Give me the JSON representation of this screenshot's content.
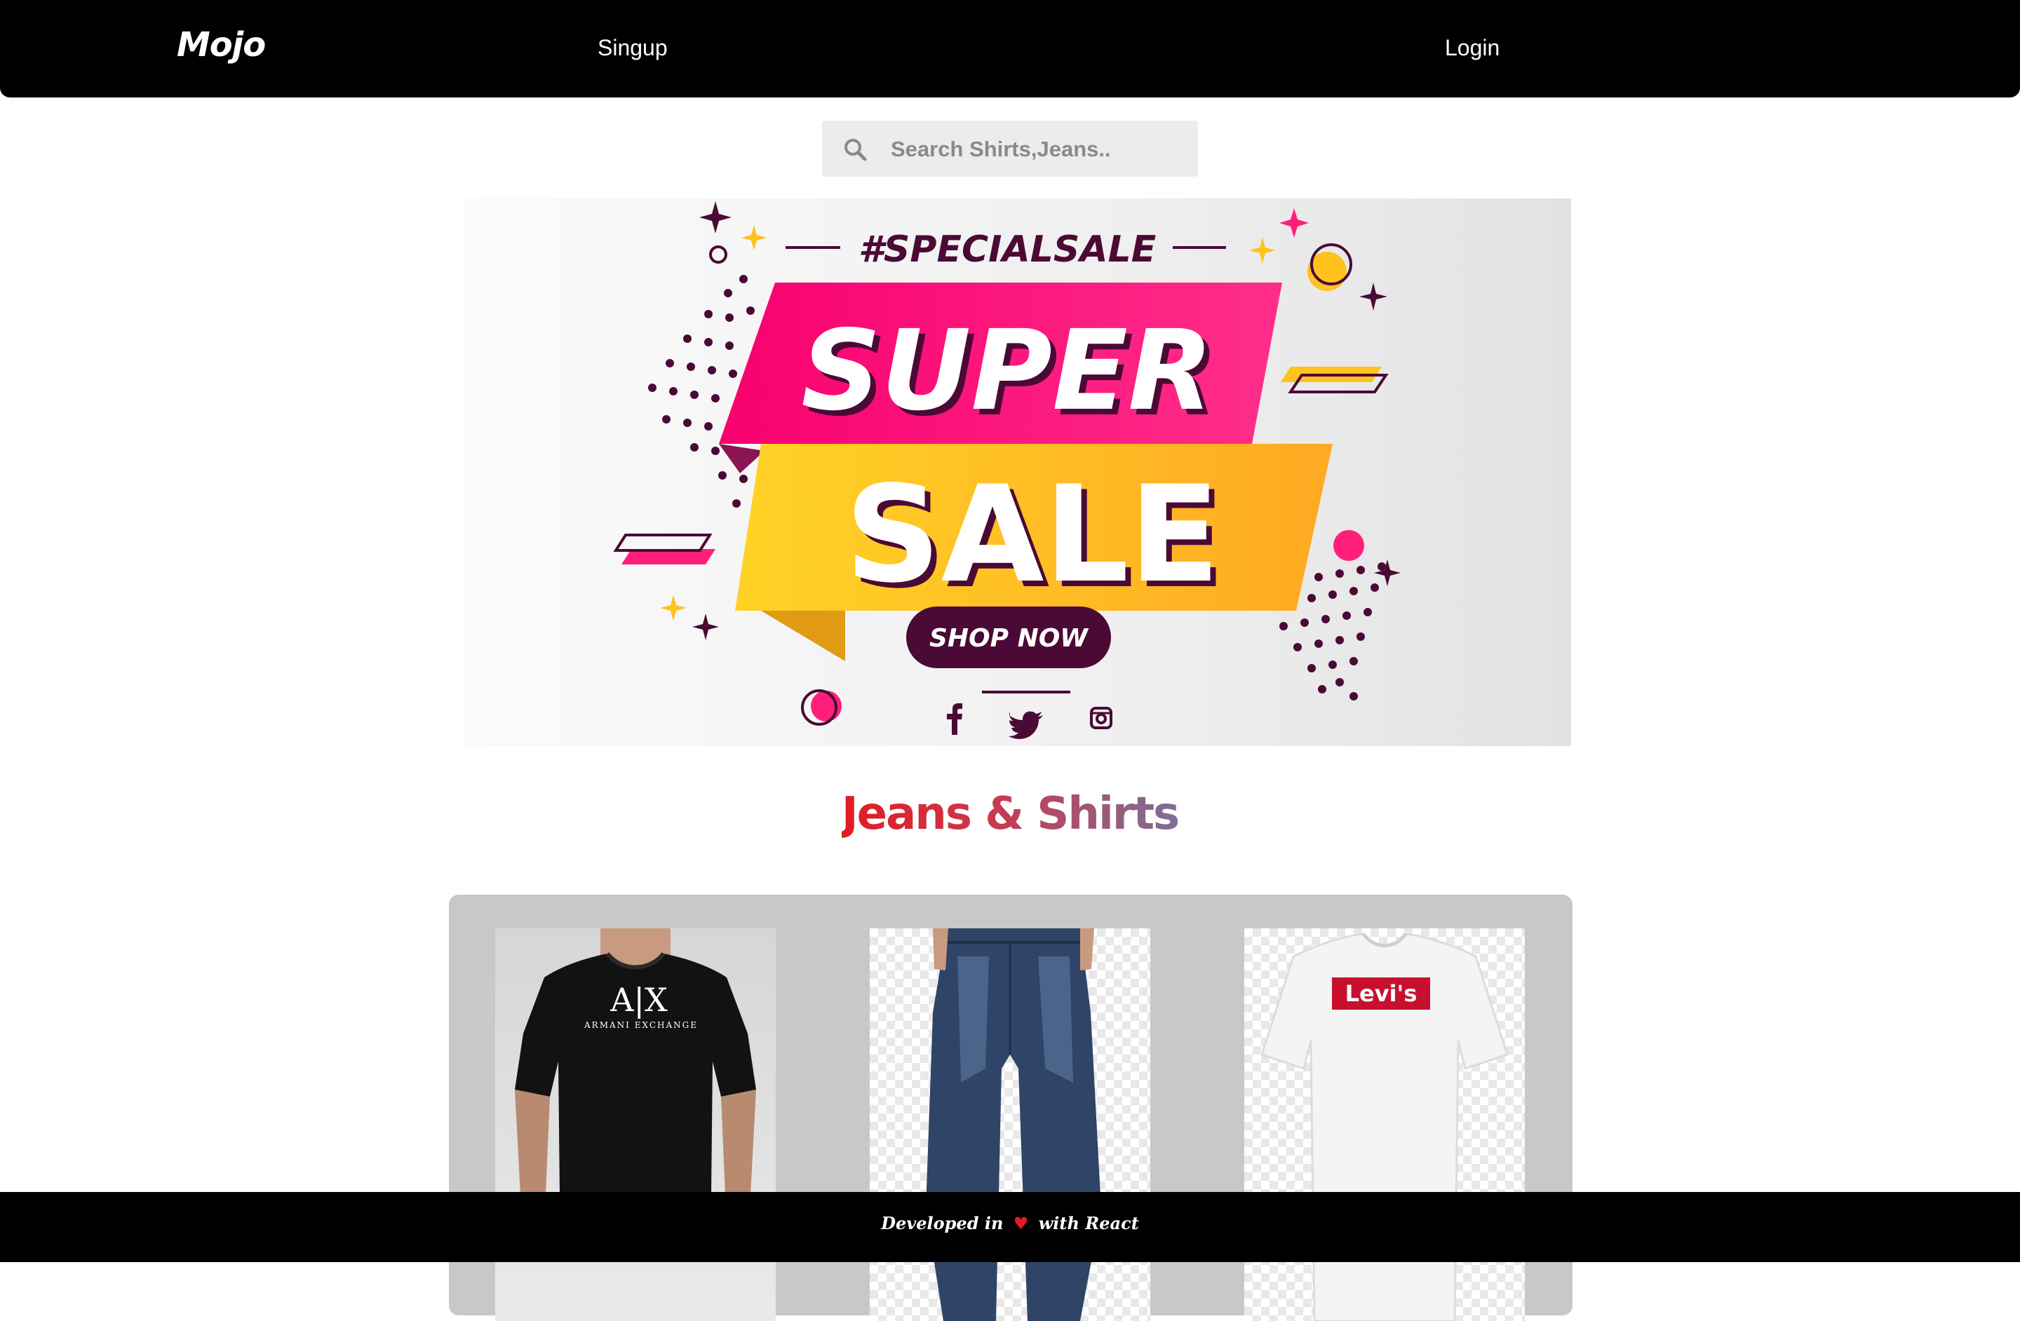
{
  "nav": {
    "brand": "Mojo",
    "signup_label": "Singup",
    "login_label": "Login"
  },
  "search": {
    "placeholder": "Search Shirts,Jeans..",
    "value": ""
  },
  "banner": {
    "hashtag": "#SPECIALSALE",
    "line1": "SUPER",
    "line2": "SALE",
    "cta": "SHOP NOW",
    "social_icons": [
      "facebook-icon",
      "twitter-icon",
      "instagram-icon"
    ],
    "colors": {
      "pink": "#ff1f7a",
      "yellow": "#ffc21f",
      "dark": "#4a0a35"
    }
  },
  "section": {
    "title": "Jeans & Shirts"
  },
  "products": [
    {
      "kind": "black t-shirt",
      "print_line1": "A|X",
      "print_line2": "ARMANI EXCHANGE"
    },
    {
      "kind": "blue jeans"
    },
    {
      "kind": "white t-shirt",
      "print_line1": "Levi's"
    }
  ],
  "footer": {
    "text_before": "Developed in",
    "heart": "♥",
    "text_after": "with React"
  }
}
